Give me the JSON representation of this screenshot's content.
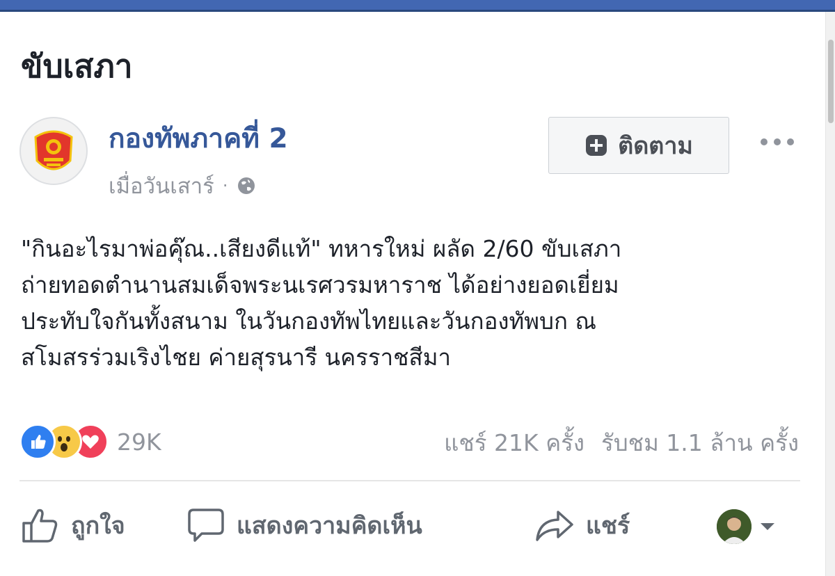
{
  "header": {
    "title": "ขับเสภา"
  },
  "post": {
    "author": "กองทัพภาคที่ 2",
    "timestamp": "เมื่อวันเสาร์",
    "separator": "·",
    "follow_label": "ติดตาม",
    "text_lines": [
      "\"กินอะไรมาพ่อคุ๊ณ..เสียงดีแท้\" ทหารใหม่ ผลัด 2/60 ขับเสภา",
      "ถ่ายทอดตำนานสมเด็จพระนเรศวรมหาราช ได้อย่างยอดเยี่ยม",
      "ประทับใจกันทั้งสนาม ในวันกองทัพไทยและวันกองทัพบก ณ",
      "สโมสรร่วมเริงไชย ค่ายสุรนารี นครราชสีมา"
    ]
  },
  "reactions": {
    "count": "29K",
    "types": [
      "like",
      "wow",
      "love"
    ]
  },
  "stats": {
    "shares": "แชร์ 21K ครั้ง",
    "views": "รับชม 1.1 ล้าน ครั้ง"
  },
  "actions": {
    "like": "ถูกใจ",
    "comment": "แสดงความคิดเห็น",
    "share": "แชร์"
  },
  "colors": {
    "brand": "#4267b2",
    "link": "#365899",
    "muted": "#90949c",
    "like": "#2f7ff0",
    "wow": "#f7c948",
    "love": "#f0405a"
  },
  "icons": [
    "globe-icon",
    "follow-plus-icon",
    "more-dots-icon",
    "like-reaction-icon",
    "wow-reaction-icon",
    "love-reaction-icon",
    "thumbs-up-icon",
    "comment-icon",
    "share-arrow-icon",
    "chevron-down-icon"
  ]
}
